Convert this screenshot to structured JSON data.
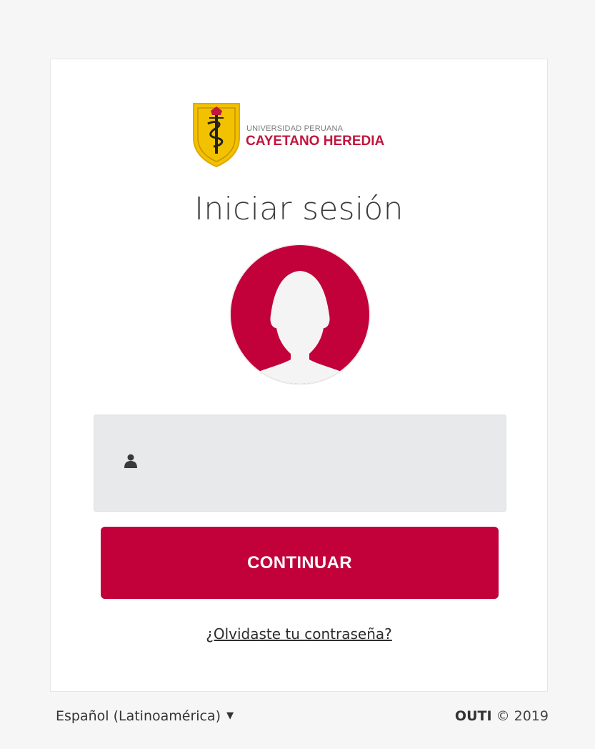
{
  "logo": {
    "line1": "UNIVERSIDAD PERUANA",
    "line2": "CAYETANO HEREDIA"
  },
  "login": {
    "title": "Iniciar sesión",
    "username_value": "",
    "username_placeholder": "",
    "continue_label": "CONTINUAR",
    "forgot_label": "¿Olvidaste tu contraseña?"
  },
  "footer": {
    "language": "Español (Latinoamérica)",
    "language_caret": "▼",
    "brand": "OUTI",
    "copyright": "© 2019"
  },
  "icons": {
    "shield": "university-shield-icon",
    "avatar": "user-avatar-icon",
    "username": "user-icon",
    "language": "caret-down-icon"
  },
  "colors": {
    "brand_red": "#c2003a",
    "logo_red": "#c0163d",
    "shield_gold": "#f2c200",
    "field_bg": "#e8e9ea"
  }
}
